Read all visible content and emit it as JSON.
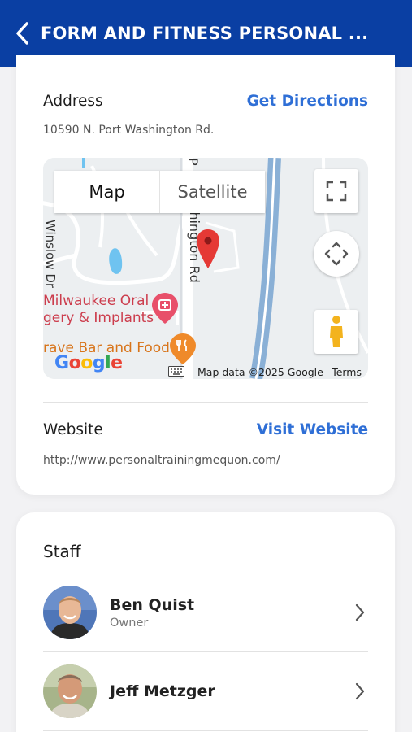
{
  "header": {
    "title": "FORM AND FITNESS PERSONAL ..."
  },
  "address": {
    "label": "Address",
    "action": "Get Directions",
    "value": "10590 N. Port Washington Rd."
  },
  "map": {
    "tabs": [
      "Map",
      "Satellite"
    ],
    "active_tab": "Map",
    "places": [
      "Milwaukee Oral",
      "gery & Implants",
      "rave Bar and Food"
    ],
    "roads": [
      "Winslow Dr",
      "shington Rd",
      "P"
    ],
    "brand": "Google",
    "attribution": "Map data ©2025 Google",
    "terms": "Terms",
    "colors": {
      "pin": "#e53935",
      "water": "#6fc3f0",
      "highway": "#8ab0d6"
    }
  },
  "website": {
    "label": "Website",
    "action": "Visit Website",
    "value": "http://www.personaltrainingmequon.com/"
  },
  "staff": {
    "title": "Staff",
    "members": [
      {
        "name": "Ben Quist",
        "role": "Owner"
      },
      {
        "name": "Jeff Metzger",
        "role": ""
      }
    ]
  },
  "colors": {
    "header_bg": "#0a3fa3",
    "link": "#2f6fd6"
  }
}
